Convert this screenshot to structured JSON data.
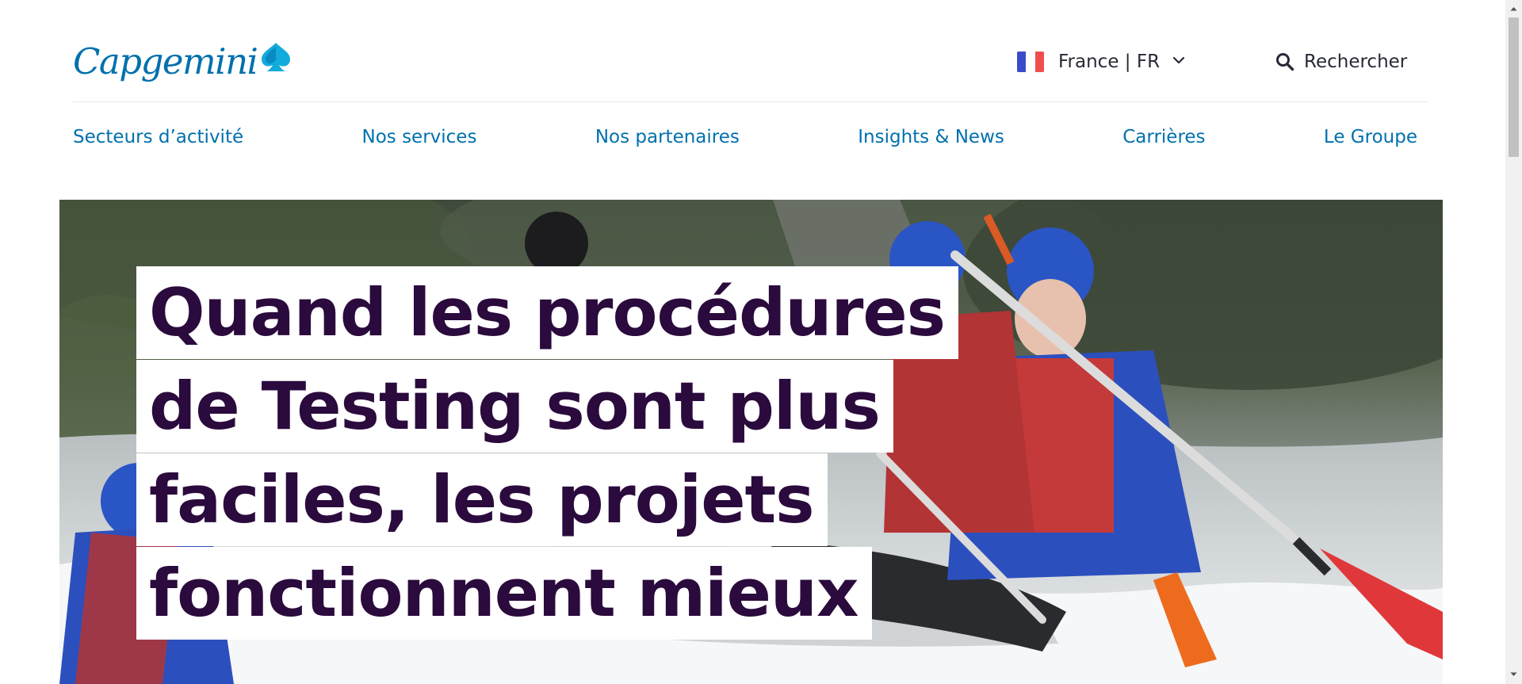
{
  "header": {
    "logo_text": "Capgemini",
    "locale": {
      "label": "France | FR",
      "flag_colors": [
        "#002395",
        "#ffffff",
        "#ed2939"
      ]
    },
    "search": {
      "label": "Rechercher"
    }
  },
  "nav": {
    "items": [
      {
        "label": "Secteurs d’activité"
      },
      {
        "label": "Nos services"
      },
      {
        "label": "Nos partenaires"
      },
      {
        "label": "Insights & News"
      },
      {
        "label": "Carrières"
      },
      {
        "label": "Le Groupe"
      }
    ]
  },
  "hero": {
    "headline": "Quand les procédures de Testing sont plus faciles, les projets fonctionnent mieux"
  },
  "colors": {
    "brand": "#0070ad",
    "headline": "#2b0a3d",
    "text": "#272936"
  },
  "icons": {
    "logo": "spade-icon",
    "locale_dropdown": "chevron-down-icon",
    "search": "search-icon"
  }
}
